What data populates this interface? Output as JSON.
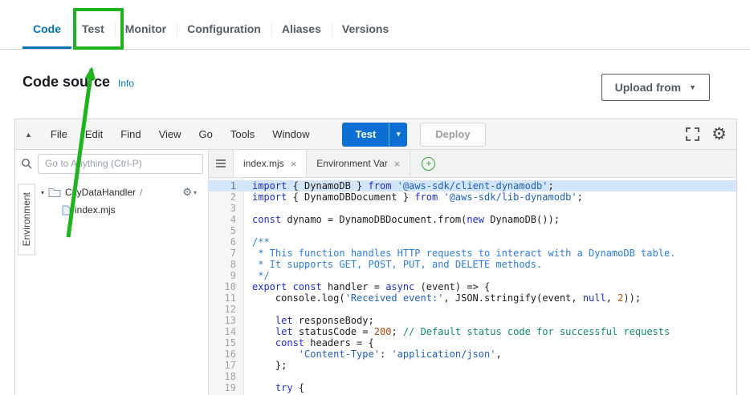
{
  "colors": {
    "accent": "#0073bb",
    "tab_inactive": "#545b64",
    "test_button": "#0b6fd4",
    "annotation": "#1fb31f",
    "highlight_line": "#d3e5f8",
    "syn_keyword": "#1f2bd6",
    "syn_string": "#1d5fc0",
    "syn_comment": "#2b7de0",
    "syn_comment_line": "#0f8a70",
    "syn_number": "#b54708"
  },
  "icons": {
    "caret_down": "▼",
    "caret_small": "▾",
    "collapse": "▲",
    "close": "×",
    "gear": "⚙",
    "plus": "+"
  },
  "tabs": {
    "items": [
      {
        "label": "Code",
        "active": true
      },
      {
        "label": "Test",
        "active": false
      },
      {
        "label": "Monitor",
        "active": false
      },
      {
        "label": "Configuration",
        "active": false
      },
      {
        "label": "Aliases",
        "active": false
      },
      {
        "label": "Versions",
        "active": false
      }
    ]
  },
  "code_source": {
    "title": "Code source",
    "info_label": "Info",
    "upload_button": "Upload from"
  },
  "toolbar": {
    "menus": [
      "File",
      "Edit",
      "Find",
      "View",
      "Go",
      "Tools",
      "Window"
    ],
    "test_button": "Test",
    "deploy_button": "Deploy"
  },
  "sidebar": {
    "search_placeholder": "Go to Anything (Ctrl-P)",
    "environment_tab": "Environment",
    "tree": {
      "folder": "CityDataHandler",
      "separator": "/",
      "file": "index.mjs"
    }
  },
  "editor": {
    "tabs": [
      {
        "label": "index.mjs",
        "active": true
      },
      {
        "label": "Environment Var",
        "active": false
      }
    ],
    "lines": [
      {
        "hl": true,
        "t": [
          [
            "k",
            "import"
          ],
          [
            "p",
            " { DynamoDB } "
          ],
          [
            "k",
            "from"
          ],
          [
            "p",
            " "
          ],
          [
            "s",
            "'@aws-sdk/client-dynamodb'"
          ],
          [
            "p",
            ";"
          ]
        ]
      },
      {
        "t": [
          [
            "k",
            "import"
          ],
          [
            "p",
            " { DynamoDBDocument } "
          ],
          [
            "k",
            "from"
          ],
          [
            "p",
            " "
          ],
          [
            "s",
            "'@aws-sdk/lib-dynamodb'"
          ],
          [
            "p",
            ";"
          ]
        ]
      },
      {
        "t": []
      },
      {
        "t": [
          [
            "k",
            "const"
          ],
          [
            "p",
            " dynamo = DynamoDBDocument.from("
          ],
          [
            "k",
            "new"
          ],
          [
            "p",
            " DynamoDB());"
          ]
        ]
      },
      {
        "t": []
      },
      {
        "t": [
          [
            "c",
            "/**"
          ]
        ]
      },
      {
        "t": [
          [
            "c",
            " * This function handles HTTP requests to interact with a DynamoDB table."
          ]
        ]
      },
      {
        "t": [
          [
            "c",
            " * It supports GET, POST, PUT, and DELETE methods."
          ]
        ]
      },
      {
        "t": [
          [
            "c",
            " */"
          ]
        ]
      },
      {
        "t": [
          [
            "k",
            "export"
          ],
          [
            "p",
            " "
          ],
          [
            "k",
            "const"
          ],
          [
            "p",
            " handler = "
          ],
          [
            "k",
            "async"
          ],
          [
            "p",
            " (event) => {"
          ]
        ]
      },
      {
        "t": [
          [
            "p",
            "    console.log("
          ],
          [
            "s",
            "'Received event:'"
          ],
          [
            "p",
            ", JSON.stringify(event, "
          ],
          [
            "k",
            "null"
          ],
          [
            "p",
            ", "
          ],
          [
            "n",
            "2"
          ],
          [
            "p",
            "));"
          ]
        ]
      },
      {
        "t": []
      },
      {
        "t": [
          [
            "p",
            "    "
          ],
          [
            "k",
            "let"
          ],
          [
            "p",
            " responseBody;"
          ]
        ]
      },
      {
        "t": [
          [
            "p",
            "    "
          ],
          [
            "k",
            "let"
          ],
          [
            "p",
            " statusCode = "
          ],
          [
            "n",
            "200"
          ],
          [
            "p",
            "; "
          ],
          [
            "c2",
            "// Default status code for successful requests"
          ]
        ]
      },
      {
        "t": [
          [
            "p",
            "    "
          ],
          [
            "k",
            "const"
          ],
          [
            "p",
            " headers = {"
          ]
        ]
      },
      {
        "t": [
          [
            "p",
            "        "
          ],
          [
            "s",
            "'Content-Type'"
          ],
          [
            "p",
            ": "
          ],
          [
            "s",
            "'application/json'"
          ],
          [
            "p",
            ","
          ]
        ]
      },
      {
        "t": [
          [
            "p",
            "    };"
          ]
        ]
      },
      {
        "t": []
      },
      {
        "t": [
          [
            "p",
            "    "
          ],
          [
            "k",
            "try"
          ],
          [
            "p",
            " {"
          ]
        ]
      }
    ]
  }
}
